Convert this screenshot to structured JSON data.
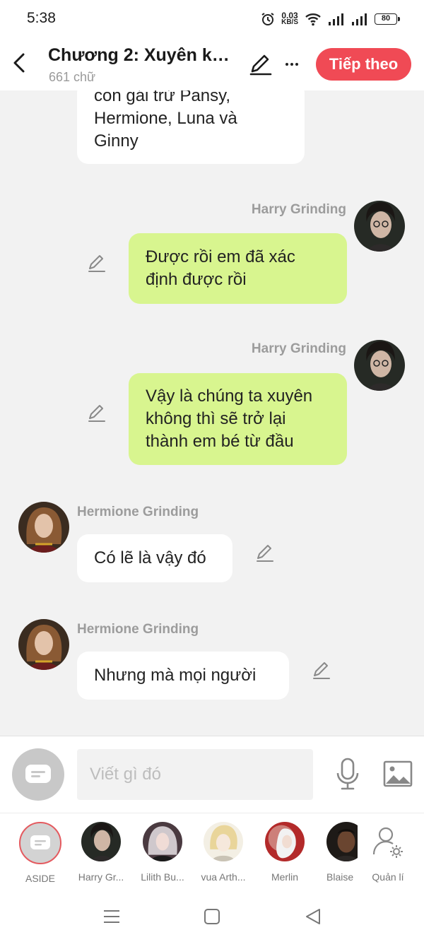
{
  "status_bar": {
    "time": "5:38",
    "net_speed_value": "0.03",
    "net_speed_unit": "KB/S",
    "battery": "80"
  },
  "header": {
    "title": "Chương 2: Xuyên khô...",
    "word_count": "661 chữ",
    "next_label": "Tiếp theo",
    "icons": [
      "back-arrow-icon",
      "pencil-icon",
      "more-icon"
    ],
    "accent_color": "#f04a55"
  },
  "messages": [
    {
      "side": "left",
      "sender": "",
      "lines": [
        "con gái trừ Pansy,",
        "Hermione, Luna và",
        "Ginny"
      ]
    },
    {
      "side": "right",
      "sender": "Harry Grinding",
      "lines": [
        "Được rồi em đã xác",
        "định được rồi"
      ]
    },
    {
      "side": "right",
      "sender": "Harry Grinding",
      "lines": [
        "Vậy là chúng ta xuyên",
        "không thì sẽ trở lại",
        "thành em bé từ đầu"
      ]
    },
    {
      "side": "left",
      "sender": "Hermione Grinding",
      "lines": [
        "Có lẽ là vậy đó"
      ]
    },
    {
      "side": "left",
      "sender": "Hermione Grinding",
      "lines": [
        "Nhưng mà mọi người"
      ]
    }
  ],
  "colors": {
    "right_bubble": "#d8f58f",
    "left_bubble": "#ffffff",
    "background": "#f2f2f2"
  },
  "input": {
    "placeholder": "Viết gì đó",
    "value": ""
  },
  "characters": [
    {
      "name": "ASIDE"
    },
    {
      "name": "Harry Gr..."
    },
    {
      "name": "Lilith Bu..."
    },
    {
      "name": "vua Arth..."
    },
    {
      "name": "Merlin"
    },
    {
      "name": "Blaise"
    },
    {
      "name": "Quản lí"
    }
  ]
}
